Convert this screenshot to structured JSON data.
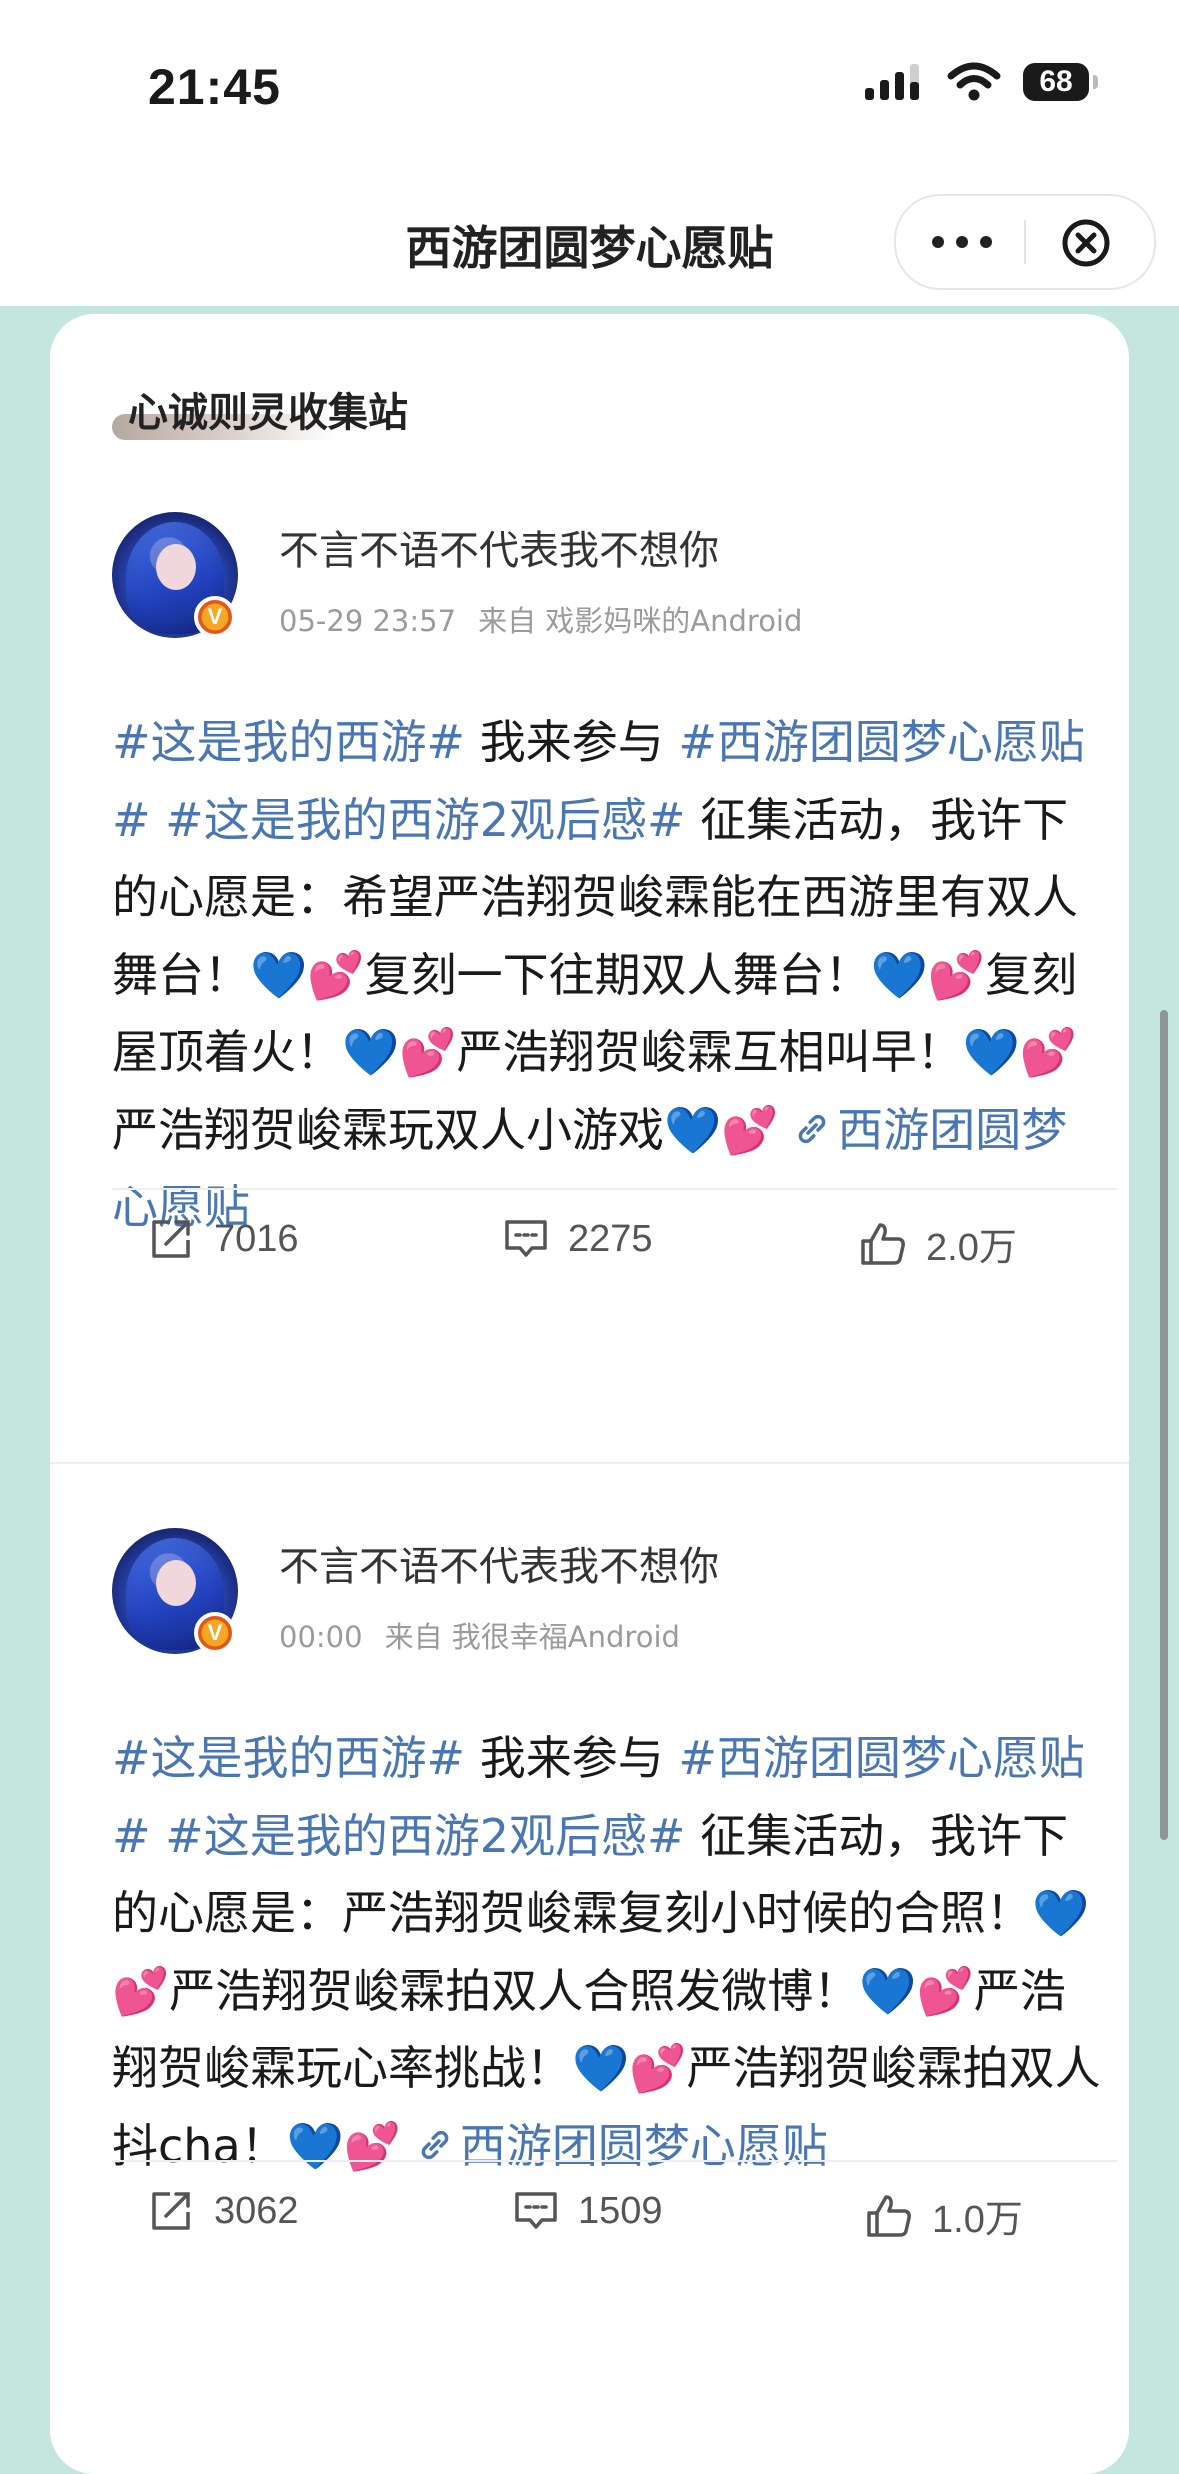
{
  "status_bar": {
    "time": "21:45",
    "battery": "68"
  },
  "nav": {
    "title": "西游团圆梦心愿贴"
  },
  "section": {
    "title": "心诚则灵收集站"
  },
  "posts": [
    {
      "username": "不言不语不代表我不想你",
      "time": "05-29 23:57",
      "source": "来自 戏影妈咪的Android",
      "tag1": "#这是我的西游#",
      "text1": " 我来参与 ",
      "tag2": "#西游团圆梦心愿贴#",
      "tag3": " #这是我的西游2观后感#",
      "text2": " 征集活动，我许下的心愿是：希望严浩翔贺峻霖能在西游里有双人舞台！",
      "wish2": "复刻一下往期双人舞台！",
      "wish3": "复刻屋顶着火！",
      "wish4": "严浩翔贺峻霖互相叫早！",
      "wish5": "严浩翔贺峻霖玩双人小游戏",
      "link": "西游团圆梦心愿贴",
      "reposts": "7016",
      "comments": "2275",
      "likes": "2.0万"
    },
    {
      "username": "不言不语不代表我不想你",
      "time": "00:00",
      "source": "来自 我很幸福Android",
      "tag1": "#这是我的西游#",
      "text1": " 我来参与 ",
      "tag2": "#西游团圆梦心愿贴#",
      "tag3": " #这是我的西游2观后感#",
      "text2": " 征集活动，我许下的心愿是：严浩翔贺峻霖复刻小时候的合照！",
      "wish2": "严浩翔贺峻霖拍双人合照发微博！",
      "wish3": "严浩翔贺峻霖玩心率挑战！",
      "wish4": "严浩翔贺峻霖拍双人抖cha！",
      "link": "西游团圆梦心愿贴",
      "reposts": "3062",
      "comments": "1509",
      "likes": "1.0万"
    }
  ],
  "emoji": {
    "blue_heart": "💙",
    "pink_hearts": "💕"
  },
  "icons": [
    "signal-icon",
    "wifi-icon",
    "battery-icon",
    "more-icon",
    "close-icon",
    "verified-icon",
    "link-icon",
    "repost-icon",
    "comment-icon",
    "like-icon"
  ],
  "colors": {
    "background": "#c4e6df",
    "link": "#4a77b4",
    "card": "#ffffff"
  }
}
